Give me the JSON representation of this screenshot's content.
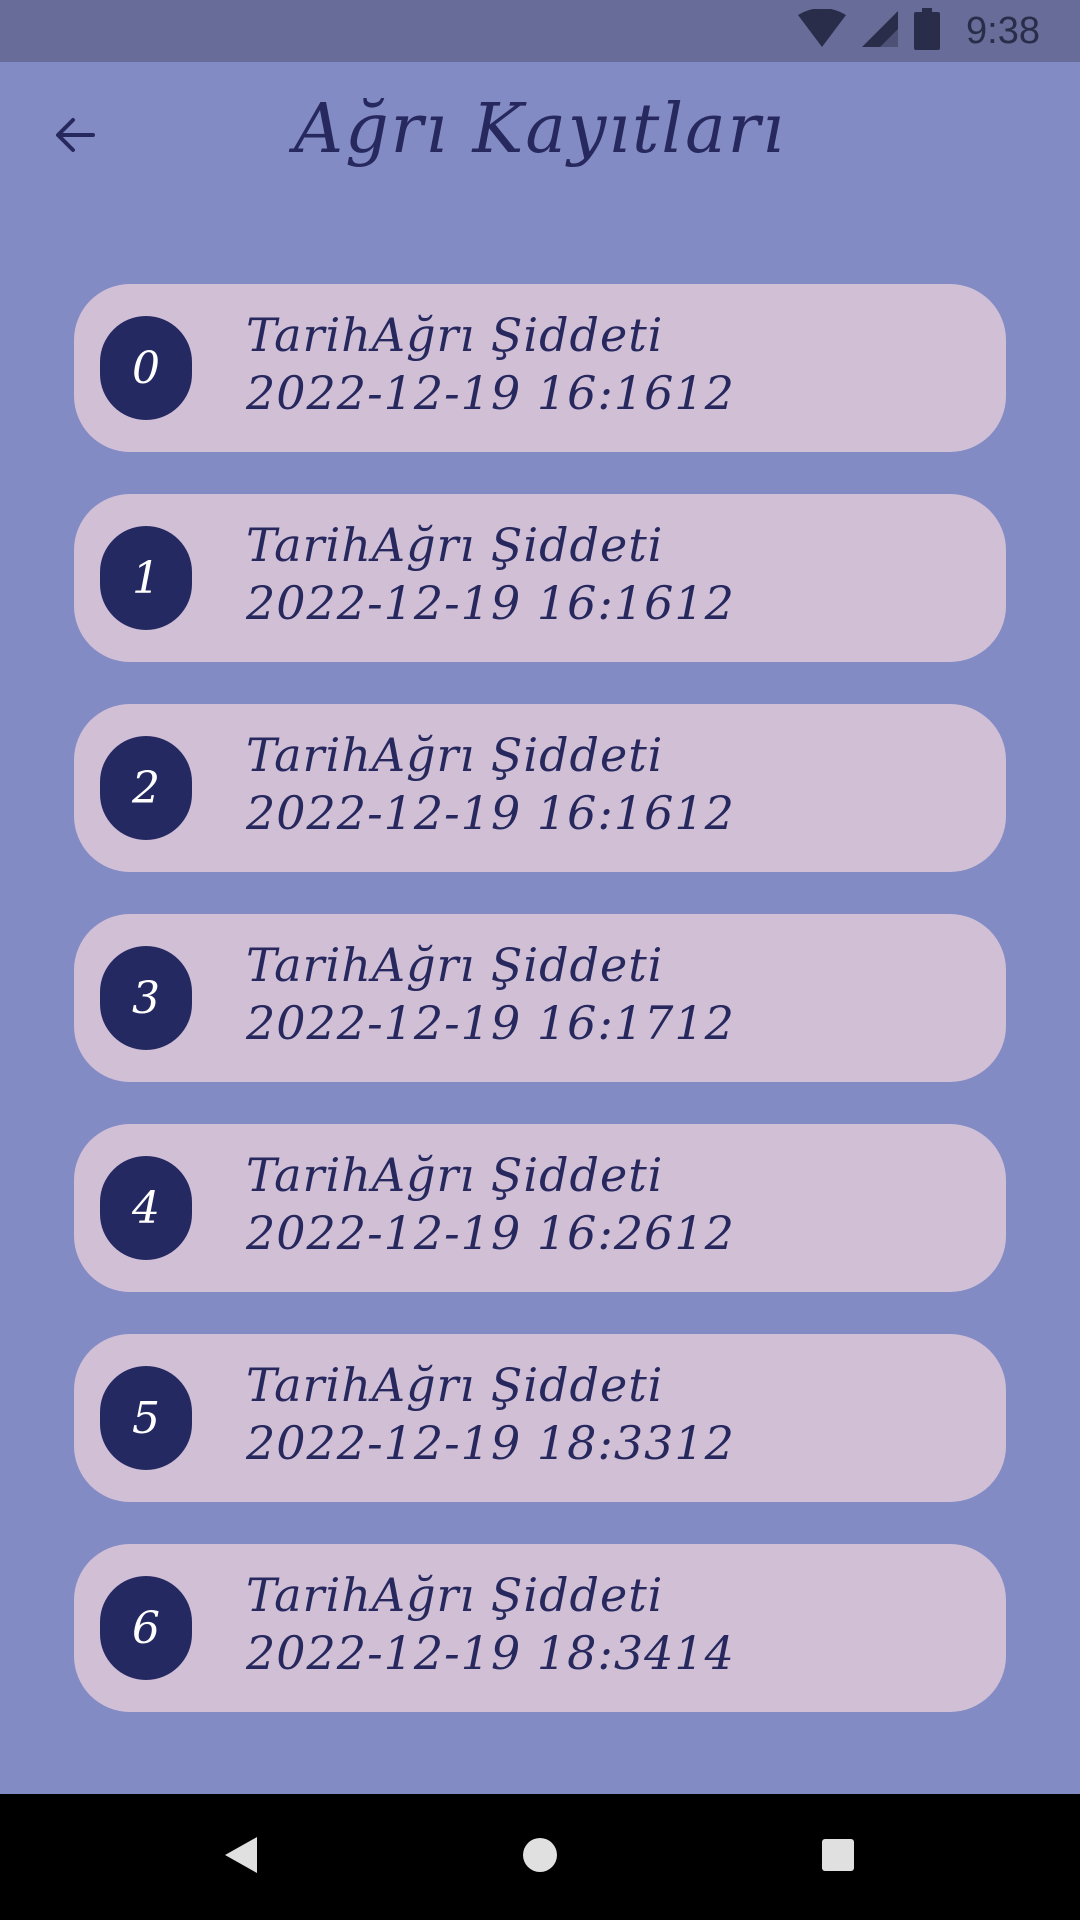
{
  "status_bar": {
    "time": "9:38",
    "icons": [
      "wifi-icon",
      "cellular-signal-icon",
      "battery-icon"
    ]
  },
  "app_bar": {
    "title": "Ağrı Kayıtları",
    "back_icon": "arrow-back-icon"
  },
  "records": [
    {
      "index": "0",
      "label": "TarihAğrı Şiddeti",
      "value": "2022-12-19 16:1612"
    },
    {
      "index": "1",
      "label": "TarihAğrı Şiddeti",
      "value": "2022-12-19 16:1612"
    },
    {
      "index": "2",
      "label": "TarihAğrı Şiddeti",
      "value": "2022-12-19 16:1612"
    },
    {
      "index": "3",
      "label": "TarihAğrı Şiddeti",
      "value": "2022-12-19 16:1712"
    },
    {
      "index": "4",
      "label": "TarihAğrı Şiddeti",
      "value": "2022-12-19 16:2612"
    },
    {
      "index": "5",
      "label": "TarihAğrı Şiddeti",
      "value": "2022-12-19 18:3312"
    },
    {
      "index": "6",
      "label": "TarihAğrı Şiddeti",
      "value": "2022-12-19 18:3414"
    }
  ],
  "nav_bar": {
    "icons": [
      "nav-back-icon",
      "nav-home-icon",
      "nav-recents-icon"
    ]
  },
  "colors": {
    "background": "#838bc5",
    "status_bar": "#676c98",
    "card": "#d1bfd6",
    "badge": "#252962",
    "text": "#26285e"
  }
}
